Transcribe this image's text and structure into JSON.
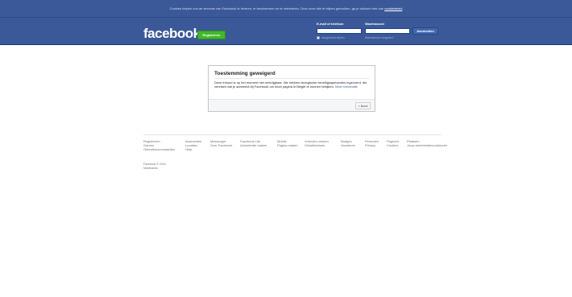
{
  "cookie_banner": {
    "text": "Cookies helpen ons de services van Facebook te leveren, te beschermen en te verbeteren. Door onze site te blijven gebruiken, ga je akkoord met ons",
    "link": "cookiebeleid"
  },
  "header": {
    "logo": "facebook",
    "signup_button": "Registreren",
    "email_label": "E-mail of telefoon",
    "email_value": "",
    "password_label": "Wachtwoord",
    "password_value": "",
    "login_button": "Aanmelden",
    "remember_label": "Aangemeld blijven",
    "forgot_link": "Wachtwoord vergeten?"
  },
  "dialog": {
    "title": "Toestemming geweigerd",
    "body": "Deze inhoud is op het moment niet verkrijgbaar. We hebben biologische beveiligingsfuncties ingevoerd, die vereisen dat je aanmeldt bij Facebook om deze pagina in België te kunnen bekijken.",
    "more_link": "Meer informatie",
    "back_button": "« Back"
  },
  "footer": {
    "columns": [
      [
        "Registreren",
        "Games",
        "Gebruiksvoorwaarden"
      ],
      [
        "Aanmelden",
        "Locaties",
        "Help"
      ],
      [
        "Messenger",
        "Over Facebook"
      ],
      [
        "Facebook Lite",
        "Advertentie maken"
      ],
      [
        "Mobile",
        "Pagina maken"
      ],
      [
        "Vrienden zoeken",
        "Ontwikkelaars"
      ],
      [
        "Badges",
        "Vacatures"
      ],
      [
        "Personen",
        "Privacy"
      ],
      [
        "Pagina's",
        "Cookies"
      ],
      [
        "Plaatsen",
        "Jouw advertentievoorkeuren"
      ]
    ],
    "copyright": "Facebook © 2016",
    "language": "Nederlands"
  }
}
